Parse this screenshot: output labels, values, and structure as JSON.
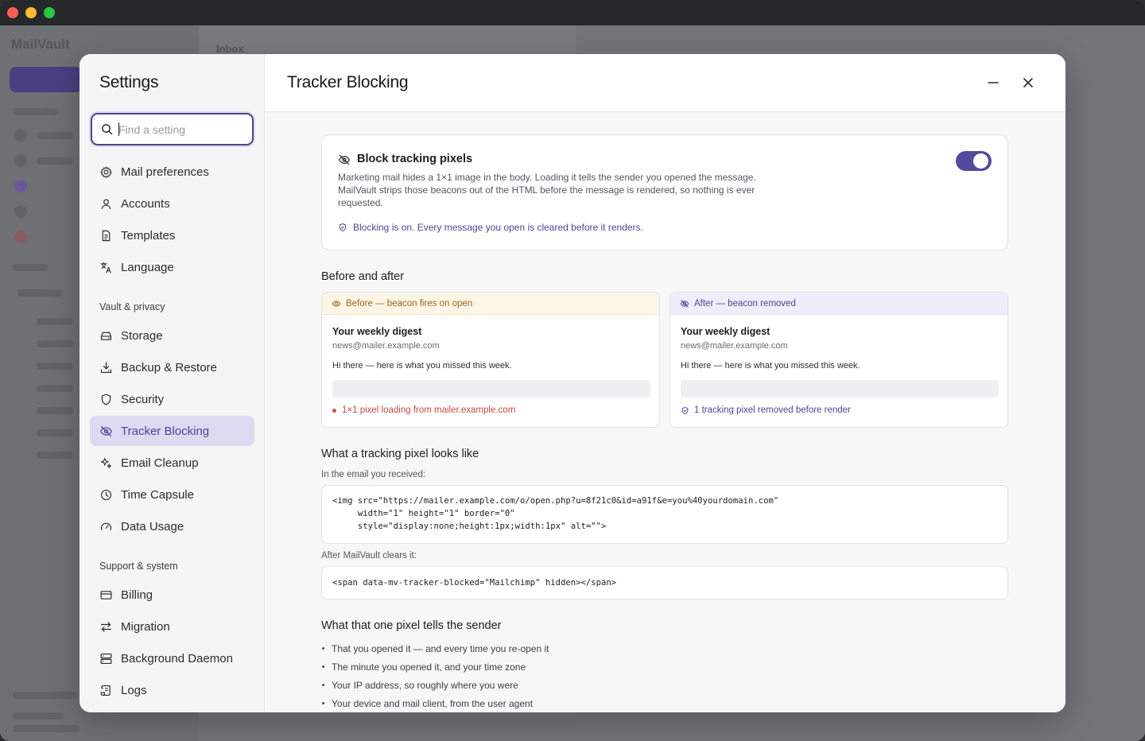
{
  "bg": {
    "brand": "MailVault",
    "inbox_title": "Inbox"
  },
  "sidebar": {
    "title": "Settings",
    "search_placeholder": "Find a setting",
    "items_top": [
      {
        "label": "Mail preferences",
        "icon": "gear-icon"
      },
      {
        "label": "Accounts",
        "icon": "user-icon"
      },
      {
        "label": "Templates",
        "icon": "document-icon"
      },
      {
        "label": "Language",
        "icon": "translate-icon"
      }
    ],
    "group_vault": "Vault & privacy",
    "items_vault": [
      {
        "label": "Storage",
        "icon": "hard-drive-icon"
      },
      {
        "label": "Backup & Restore",
        "icon": "download-tray-icon"
      },
      {
        "label": "Security",
        "icon": "shield-icon"
      },
      {
        "label": "Tracker Blocking",
        "icon": "eye-off-icon"
      },
      {
        "label": "Email Cleanup",
        "icon": "sparkles-icon"
      },
      {
        "label": "Time Capsule",
        "icon": "clock-icon"
      },
      {
        "label": "Data Usage",
        "icon": "gauge-icon"
      }
    ],
    "group_support": "Support & system",
    "items_support": [
      {
        "label": "Billing",
        "icon": "credit-card-icon"
      },
      {
        "label": "Migration",
        "icon": "arrows-swap-icon"
      },
      {
        "label": "Background Daemon",
        "icon": "server-icon"
      },
      {
        "label": "Logs",
        "icon": "scroll-icon"
      }
    ]
  },
  "content": {
    "title": "Tracker Blocking",
    "card": {
      "title": "Block tracking pixels",
      "desc": "Marketing mail hides a 1×1 image in the body. Loading it tells the sender you opened the message. MailVault strips those beacons out of the HTML before the message is rendered, so nothing is ever requested.",
      "status": "Blocking is on. Every message you open is cleared before it renders.",
      "toggle_on": true
    },
    "before_after": {
      "heading": "Before and after",
      "before": {
        "band": "Before — beacon fires on open",
        "subject": "Your weekly digest",
        "from": "news@mailer.example.com",
        "body": "Hi there — here is what you missed this week.",
        "note": "1×1 pixel loading from mailer.example.com"
      },
      "after": {
        "band": "After — beacon removed",
        "subject": "Your weekly digest",
        "from": "news@mailer.example.com",
        "body": "Hi there — here is what you missed this week.",
        "note": "1 tracking pixel removed before render"
      }
    },
    "pixel": {
      "heading": "What a tracking pixel looks like",
      "received_label": "In the email you received:",
      "code_before_1": "<img src=\"https://mailer.example.com/o/open.php?u=8f21c0&id=a91f&e=you%40yourdomain.com\"",
      "code_before_2": "     width=\"1\" height=\"1\" border=\"0\"",
      "code_before_3": "     style=\"display:none;height:1px;width:1px\" alt=\"\">",
      "after_label": "After MailVault clears it:",
      "code_after": "<span data-mv-tracker-blocked=\"Mailchimp\" hidden></span>"
    },
    "tells": {
      "heading": "What that one pixel tells the sender",
      "items": [
        "That you opened it — and every time you re-open it",
        "The minute you opened it, and your time zone",
        "Your IP address, so roughly where you were",
        "Your device and mail client, from the user agent"
      ]
    }
  },
  "colors": {
    "accent": "#514a9d",
    "active_bg": "#dcdaf1",
    "warn": "#a0621a",
    "error": "#c04a41"
  }
}
